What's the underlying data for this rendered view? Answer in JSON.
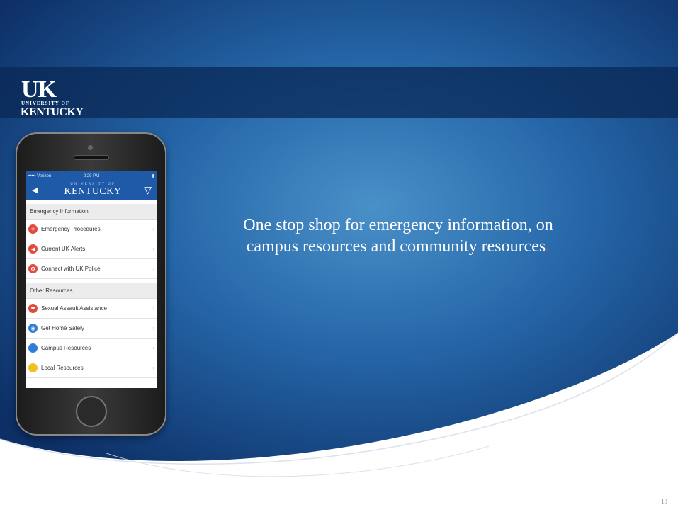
{
  "slide": {
    "headline_line1": "One stop shop for emergency information, on",
    "headline_line2": "campus resources and community resources",
    "headline_dot": ".",
    "page_number": "18"
  },
  "logo": {
    "uk": "UK",
    "university_of": "UNIVERSITY OF",
    "kentucky": "KENTUCKY"
  },
  "phone": {
    "status": {
      "carrier": "••••• Verizon",
      "time": "2:29 PM",
      "battery": "▮"
    },
    "nav": {
      "univ": "UNIVERSITY OF",
      "title": "KENTUCKY",
      "back_icon": "back-arrow-icon",
      "shield_icon": "shield-icon"
    },
    "sections": [
      {
        "title": "Emergency Information",
        "items": [
          {
            "label": "Emergency Procedures",
            "icon": "alert-icon",
            "color": "#e04a3f"
          },
          {
            "label": "Current UK Alerts",
            "icon": "megaphone-icon",
            "color": "#e04a3f"
          },
          {
            "label": "Connect with UK Police",
            "icon": "police-icon",
            "color": "#e04a3f"
          }
        ]
      },
      {
        "title": "Other Resources",
        "items": [
          {
            "label": "Sexual Assault Assistance",
            "icon": "support-icon",
            "color": "#e04a3f"
          },
          {
            "label": "Get Home Safely",
            "icon": "car-icon",
            "color": "#2f7fd6"
          },
          {
            "label": "Campus Resources",
            "icon": "info-icon",
            "color": "#2f7fd6"
          },
          {
            "label": "Local Resources",
            "icon": "info-icon",
            "color": "#f0c020"
          }
        ]
      }
    ]
  }
}
